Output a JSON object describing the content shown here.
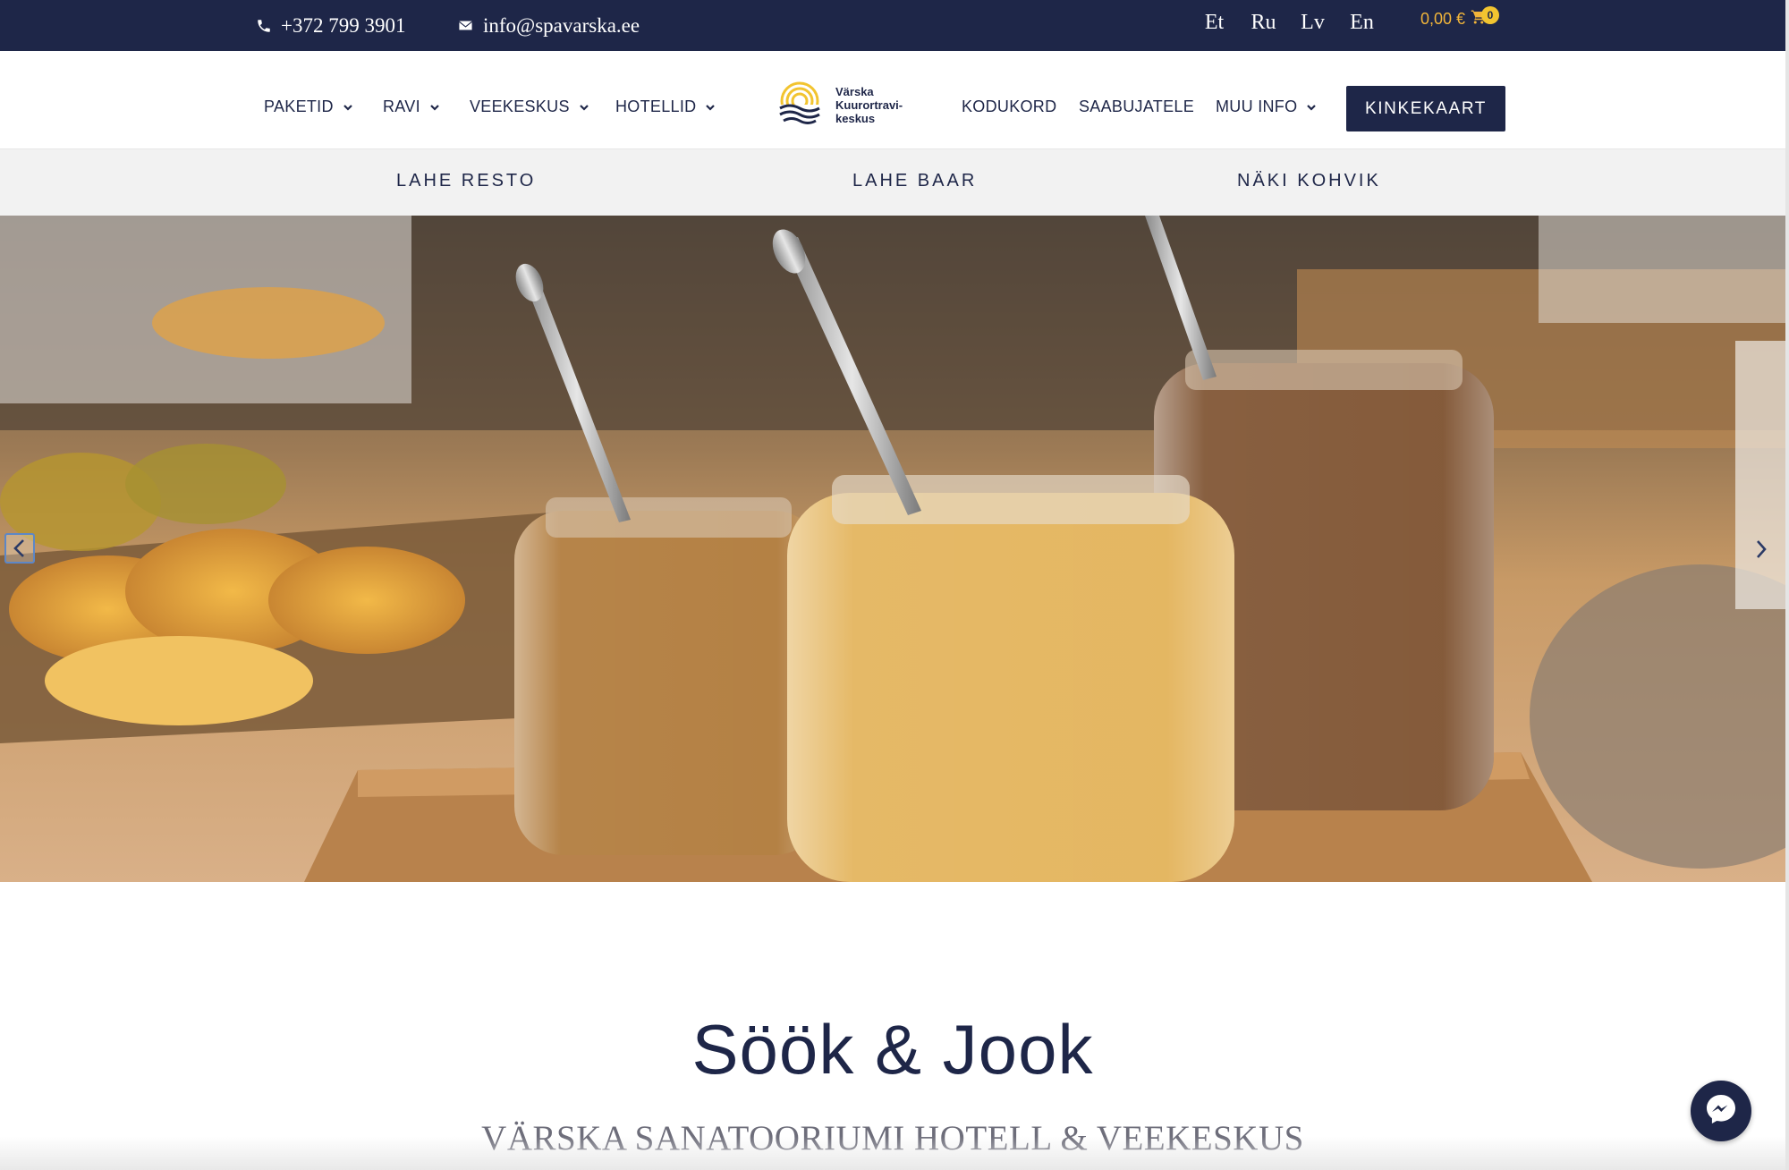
{
  "topbar": {
    "phone": "+372 799 3901",
    "email": "info@spavarska.ee",
    "languages": [
      "Et",
      "Ru",
      "Lv",
      "En"
    ],
    "cart_total": "0,00 €",
    "cart_count": "0"
  },
  "nav": {
    "left": [
      "PAKETID",
      "RAVI",
      "VEEKESKUS",
      "HOTELLID"
    ],
    "right_plain": [
      "KODUKORD",
      "SAABUJATELE"
    ],
    "right_dropdown": "MUU INFO",
    "gift_button": "KINKEKAART"
  },
  "logo": {
    "line1": "Värska",
    "line2": "Kuurortravi-",
    "line3": "keskus"
  },
  "subnav": [
    "LAHE RESTO",
    "LAHE BAAR",
    "NÄKI KOHVIK"
  ],
  "hero": {
    "image_alt": "Glass jars of cereal and granola on a breakfast buffet"
  },
  "content": {
    "title": "Söök & Jook",
    "subtitle": "VÄRSKA SANATOORIUMI HOTELL & VEEKESKUS"
  },
  "colors": {
    "navy": "#1e2648",
    "accent_gold": "#f2b53a",
    "subnav_bg": "#f2f2f2"
  },
  "icons": [
    "phone-icon",
    "mail-icon",
    "cart-icon",
    "chevron-down-icon",
    "chevron-left-icon",
    "chevron-right-icon",
    "messenger-icon"
  ]
}
